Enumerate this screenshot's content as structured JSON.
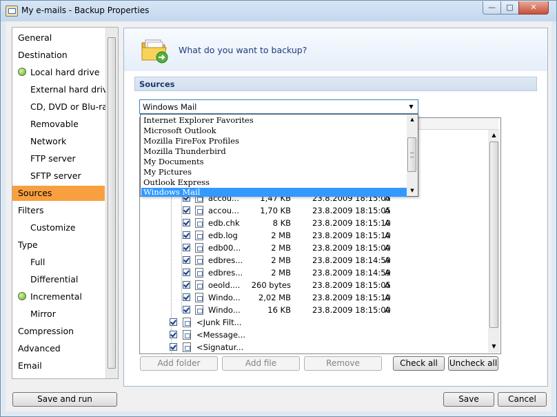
{
  "window": {
    "title": "My e-mails - Backup Properties",
    "controls": {
      "minimize": "—",
      "maximize": "□",
      "close": "✕"
    }
  },
  "nav": {
    "items": [
      {
        "label": "General",
        "level": 0
      },
      {
        "label": "Destination",
        "level": 0
      },
      {
        "label": "Local hard drive",
        "level": 1,
        "dot": true
      },
      {
        "label": "External hard drive",
        "level": 1
      },
      {
        "label": "CD, DVD or Blu-ray",
        "level": 1
      },
      {
        "label": "Removable",
        "level": 1
      },
      {
        "label": "Network",
        "level": 1
      },
      {
        "label": "FTP server",
        "level": 1
      },
      {
        "label": "SFTP server",
        "level": 1
      },
      {
        "label": "Sources",
        "level": 0,
        "selected": true
      },
      {
        "label": "Filters",
        "level": 0
      },
      {
        "label": "Customize",
        "level": 1
      },
      {
        "label": "Type",
        "level": 0
      },
      {
        "label": "Full",
        "level": 1
      },
      {
        "label": "Differential",
        "level": 1
      },
      {
        "label": "Incremental",
        "level": 1,
        "dot": true
      },
      {
        "label": "Mirror",
        "level": 1
      },
      {
        "label": "Compression",
        "level": 0
      },
      {
        "label": "Advanced",
        "level": 0
      },
      {
        "label": "Email",
        "level": 0
      }
    ]
  },
  "header": {
    "question": "What do you want to backup?"
  },
  "section": {
    "title": "Sources"
  },
  "combo": {
    "value": "Windows Mail",
    "options": [
      "Internet Explorer Favorites",
      "Microsoft Outlook",
      "Mozilla FireFox Profiles",
      "Mozilla Thunderbird",
      "My Documents",
      "My Pictures",
      "Outlook Express",
      "Windows Mail"
    ],
    "selected_index": 7
  },
  "files": [
    {
      "name": "accou...",
      "size": "1,47 KB",
      "date": "23.8.2009 18:15:05",
      "attr": "A"
    },
    {
      "name": "accou...",
      "size": "1,70 KB",
      "date": "23.8.2009 18:15:05",
      "attr": "A"
    },
    {
      "name": "edb.chk",
      "size": "8 KB",
      "date": "23.8.2009 18:15:10",
      "attr": "A"
    },
    {
      "name": "edb.log",
      "size": "2 MB",
      "date": "23.8.2009 18:15:10",
      "attr": "A"
    },
    {
      "name": "edb00...",
      "size": "2 MB",
      "date": "23.8.2009 18:15:00",
      "attr": "A"
    },
    {
      "name": "edbres...",
      "size": "2 MB",
      "date": "23.8.2009 18:14:59",
      "attr": "A"
    },
    {
      "name": "edbres...",
      "size": "2 MB",
      "date": "23.8.2009 18:14:59",
      "attr": "A"
    },
    {
      "name": "oeold....",
      "size": "260 bytes",
      "date": "23.8.2009 18:15:05",
      "attr": "A"
    },
    {
      "name": "Windo...",
      "size": "2,02 MB",
      "date": "23.8.2009 18:15:10",
      "attr": "A"
    },
    {
      "name": "Windo...",
      "size": "16 KB",
      "date": "23.8.2009 18:15:00",
      "attr": "A"
    }
  ],
  "folders": [
    {
      "name": "<Junk Filt..."
    },
    {
      "name": "<Message..."
    },
    {
      "name": "<Signatur..."
    }
  ],
  "source_buttons": {
    "add_folder": "Add folder",
    "add_file": "Add file",
    "remove": "Remove",
    "check_all": "Check all",
    "uncheck_all": "Uncheck all"
  },
  "footer": {
    "save_and_run": "Save and run",
    "save": "Save",
    "cancel": "Cancel"
  },
  "colors": {
    "selected_nav": "#f8a040",
    "selected_option": "#3399ff",
    "status_dot": "#6fa83a"
  }
}
